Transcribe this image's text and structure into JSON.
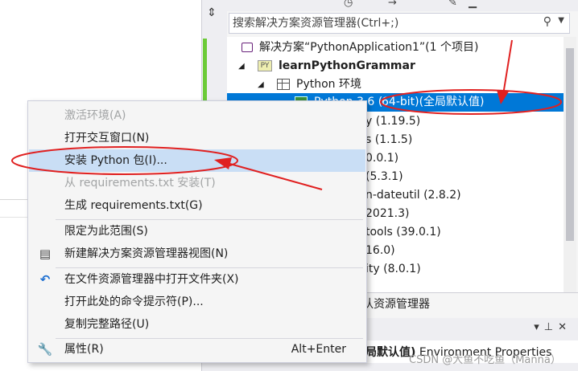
{
  "search": {
    "placeholder": "搜索解决方案资源管理器(Ctrl+;)"
  },
  "tree": {
    "solution": "解决方案“PythonApplication1”(1 个项目)",
    "project": "learnPythonGrammar",
    "env_group": "Python 环境",
    "selected_env_prefix": "Python 3.6 (",
    "selected_env_highlight": "64-bit)(全局默认值)",
    "packages": [
      "y (1.19.5)",
      "s (1.1.5)",
      "0.0.1)",
      "(5.3.1)",
      "n-dateutil (2.8.2)",
      "2021.3)",
      "tools (39.0.1)",
      "16.0)",
      "ity (8.0.1)"
    ]
  },
  "se_tab": {
    "label": "队资源管理器"
  },
  "properties": {
    "selected_bold": "局默认值)",
    "selected_rest": " Environment Properties"
  },
  "watermark": "CSDN @大鱼不吃鱼（Manna）",
  "context_menu": {
    "items": [
      {
        "label": "激活环境(A)",
        "disabled": true
      },
      {
        "label": "打开交互窗口(N)"
      },
      {
        "label": "安装 Python 包(I)...",
        "highlighted": true
      },
      {
        "label": "从 requirements.txt 安装(T)",
        "disabled": true
      },
      {
        "label": "生成 requirements.txt(G)"
      },
      {
        "label": "限定为此范围(S)"
      },
      {
        "label": "新建解决方案资源管理器视图(N)",
        "icon": "new-view-icon"
      },
      {
        "label": "在文件资源管理器中打开文件夹(X)",
        "icon": "refresh-arrow-icon"
      },
      {
        "label": "打开此处的命令提示符(P)..."
      },
      {
        "label": "复制完整路径(U)"
      },
      {
        "label": "属性(R)",
        "shortcut": "Alt+Enter",
        "icon": "wrench-icon"
      }
    ]
  },
  "colors": {
    "selection": "#0078d7",
    "menu_highlight": "#c9def5",
    "annotation_red": "#e02020",
    "status_green": "#6ccb38"
  }
}
